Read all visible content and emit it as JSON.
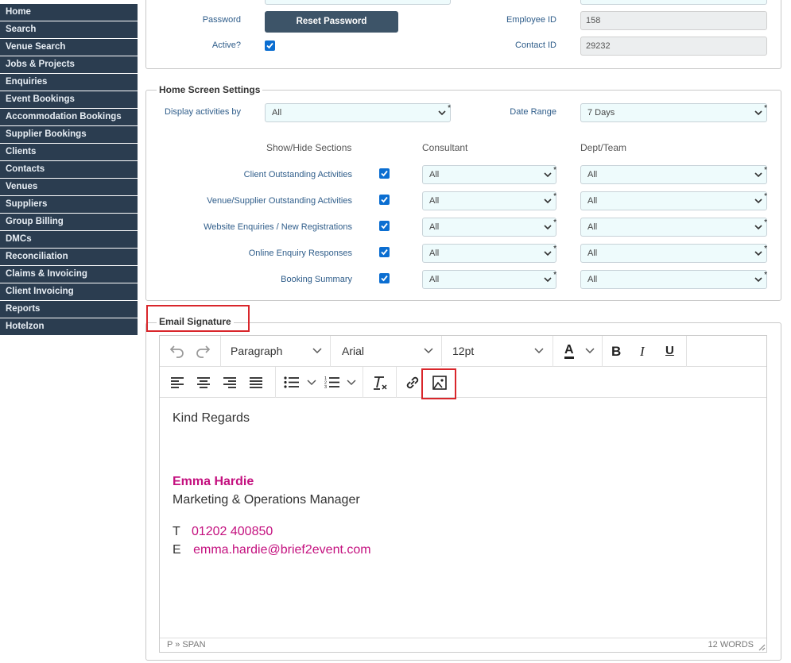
{
  "sidebar": {
    "items": [
      {
        "label": "Home"
      },
      {
        "label": "Search"
      },
      {
        "label": "Venue Search"
      },
      {
        "label": "Jobs & Projects"
      },
      {
        "label": "Enquiries"
      },
      {
        "label": "Event Bookings"
      },
      {
        "label": "Accommodation Bookings"
      },
      {
        "label": "Supplier Bookings"
      },
      {
        "label": "Clients"
      },
      {
        "label": "Contacts"
      },
      {
        "label": "Venues"
      },
      {
        "label": "Suppliers"
      },
      {
        "label": "Group Billing"
      },
      {
        "label": "DMCs"
      },
      {
        "label": "Reconciliation"
      },
      {
        "label": "Claims & Invoicing"
      },
      {
        "label": "Client Invoicing"
      },
      {
        "label": "Reports"
      },
      {
        "label": "Hotelzon"
      }
    ]
  },
  "account": {
    "password_label": "Password",
    "reset_button": "Reset Password",
    "active_label": "Active?",
    "employee_id_label": "Employee ID",
    "employee_id_value": "158",
    "contact_id_label": "Contact ID",
    "contact_id_value": "29232"
  },
  "home_settings": {
    "legend": "Home Screen Settings",
    "display_by_label": "Display activities by",
    "display_by_value": "All",
    "date_range_label": "Date Range",
    "date_range_value": "7 Days",
    "col_sections": "Show/Hide Sections",
    "col_consultant": "Consultant",
    "col_dept": "Dept/Team",
    "rows": [
      {
        "label": "Client Outstanding Activities",
        "consultant": "All",
        "dept": "All"
      },
      {
        "label": "Venue/Supplier Outstanding Activities",
        "consultant": "All",
        "dept": "All"
      },
      {
        "label": "Website Enquiries / New Registrations",
        "consultant": "All",
        "dept": "All"
      },
      {
        "label": "Online Enquiry Responses",
        "consultant": "All",
        "dept": "All"
      },
      {
        "label": "Booking Summary",
        "consultant": "All",
        "dept": "All"
      }
    ]
  },
  "signature": {
    "legend": "Email Signature",
    "toolbar": {
      "block_format": "Paragraph",
      "font_family": "Arial",
      "font_size": "12pt",
      "text_color_glyph": "A",
      "bold_glyph": "B",
      "italic_glyph": "I",
      "underline_glyph": "U"
    },
    "content": {
      "greeting": "Kind Regards",
      "name": "Emma Hardie",
      "title": "Marketing & Operations Manager",
      "tel_prefix": "T",
      "tel": "01202 400850",
      "email_prefix": "E",
      "email": "emma.hardie@brief2event.com"
    },
    "status_path": "P » SPAN",
    "word_count": "12 WORDS"
  },
  "colors": {
    "sidebar_bg": "#2b3d50",
    "accent_magenta": "#c4117f",
    "highlight_red": "#d9262b",
    "checkbox_blue": "#0b6ed1"
  }
}
